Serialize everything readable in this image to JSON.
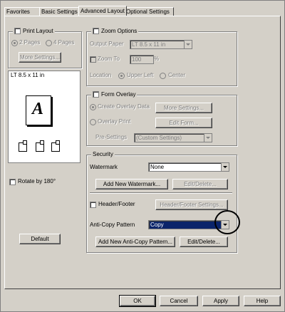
{
  "tabs": [
    {
      "label": "Favorites",
      "active": false
    },
    {
      "label": "Basic Settings",
      "active": false
    },
    {
      "label": "Advanced Layout",
      "active": true
    },
    {
      "label": "Optional Settings",
      "active": false
    }
  ],
  "print_layout": {
    "label": "Print Layout",
    "option_2pages": "2 Pages",
    "option_4pages": "4 Pages",
    "more_settings": "More Settings..."
  },
  "preview": {
    "paper_label": "LT 8.5 x 11 in",
    "glyph": "A"
  },
  "rotate_label": "Rotate by 180°",
  "default_button": "Default",
  "zoom": {
    "label": "Zoom Options",
    "output_paper_label": "Output Paper",
    "output_paper_value": "LT 8.5 x 11 in",
    "zoom_to_label": "Zoom To",
    "zoom_value": "100",
    "percent": "%",
    "location_label": "Location",
    "upper_left": "Upper Left",
    "center": "Center"
  },
  "form_overlay": {
    "label": "Form Overlay",
    "create_overlay": "Create Overlay Data",
    "more_settings": "More Settings...",
    "overlay_print": "Overlay Print",
    "edit_form": "Edit Form...",
    "pre_settings_label": "Pre-Settings",
    "pre_settings_value": "(Custom Settings)"
  },
  "security": {
    "label": "Security",
    "watermark_label": "Watermark",
    "watermark_value": "None",
    "add_watermark": "Add New Watermark...",
    "edit_delete": "Edit/Delete...",
    "header_footer_label": "Header/Footer",
    "header_footer_settings": "Header/Footer Settings...",
    "anti_copy_label": "Anti-Copy Pattern",
    "anti_copy_value": "Copy",
    "add_anti_copy": "Add New Anti-Copy Pattern...",
    "edit_delete_2": "Edit/Delete..."
  },
  "footer_buttons": {
    "ok": "OK",
    "cancel": "Cancel",
    "apply": "Apply",
    "help": "Help"
  }
}
